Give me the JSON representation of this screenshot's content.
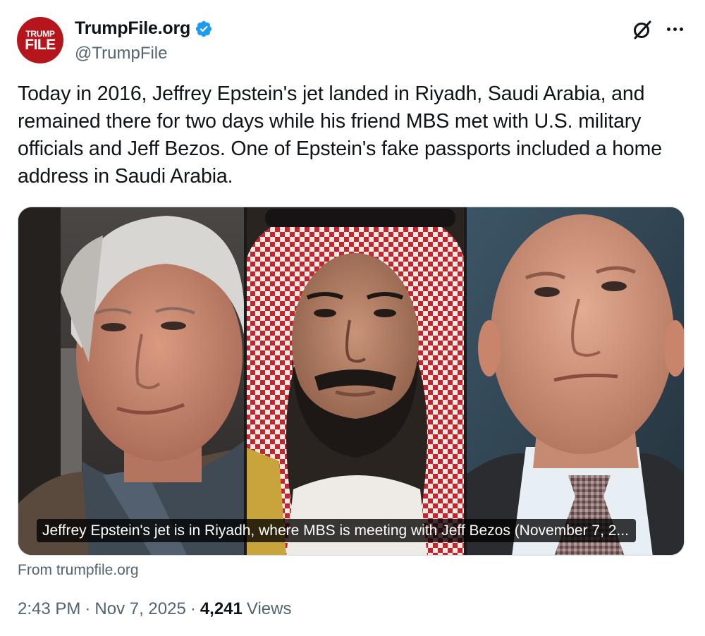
{
  "author": {
    "avatar_logo_top": "TRUMP",
    "avatar_logo_bottom": "FILE",
    "display_name": "TrumpFile.org",
    "handle": "@TrumpFile",
    "verified_color": "#1d9bf0"
  },
  "header_icons": [
    "grok-icon",
    "more-options-icon"
  ],
  "tweet": {
    "text": "Today in 2016, Jeffrey Epstein's jet landed in Riyadh, Saudi Arabia, and remained there for two days while his friend MBS met with U.S. military officials and Jeff Bezos. One of Epstein's fake passports included a home address in Saudi Arabia."
  },
  "media": {
    "caption": "Jeffrey Epstein's jet is in Riyadh, where MBS is meeting with Jeff Bezos (November 7, 2...",
    "source": "From trumpfile.org"
  },
  "meta": {
    "time": "2:43 PM",
    "date": "Nov 7, 2025",
    "views_count": "4,241",
    "views_label": "Views"
  }
}
